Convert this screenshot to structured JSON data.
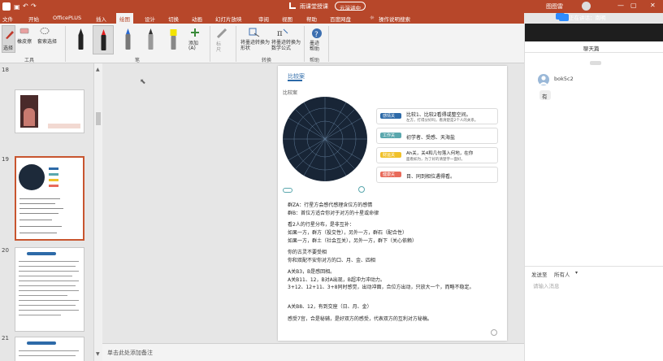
{
  "titlebar": {
    "lecture": "雨课堂授课",
    "status": "云演讲中",
    "user": "图图雷",
    "live_label": "正在讲话：南明"
  },
  "menu": [
    "文件",
    "开始",
    "OfficePLUS",
    "插入",
    "绘图",
    "设计",
    "切换",
    "动画",
    "幻灯片放映",
    "审阅",
    "视图",
    "帮助",
    "百度网盘",
    "操作说明搜索"
  ],
  "ribbon": {
    "tools": [
      "选择",
      "橡皮擦",
      "套索选择"
    ],
    "tools_group": "工具",
    "pens_group": "笔",
    "add_pen": "添加",
    "add_pen_sub": "(A)",
    "ruler": "标尺",
    "convert_shape": "将墨迹转换为形状",
    "convert_math": "将墨迹转换为数学公式",
    "convert_group": "转换",
    "help_btn": "墨迹帮助",
    "help_group": "帮助"
  },
  "thumbs": {
    "numbers": [
      "18",
      "19",
      "20",
      "21"
    ]
  },
  "slide": {
    "header": "比较案",
    "subheader": "比较案",
    "callouts": [
      {
        "tag": "感情关",
        "text": "比较1、比较2看得或整空间。",
        "sub": "左方，打得分好吗，看清楚是2个人的关系。",
        "color": "#2d6aa8"
      },
      {
        "tag": "工作关",
        "text": "初学者、受感、天海盐",
        "sub": "",
        "color": "#5aa7ad"
      },
      {
        "tag": "财运关",
        "text": "Ah关，关4和几句落入何地，在你",
        "sub": "面看如为，为了好的清楚字一面好。",
        "color": "#f0c12a"
      },
      {
        "tag": "健康关",
        "text": "目、同到相位遇得看。",
        "sub": "",
        "color": "#e86a5a"
      }
    ],
    "lines": [
      "群ZA：行星方会感代感理含位方的感情",
      "群B：首位方适合你对于对方的十星或命律",
      "看2人的行星分布，是非互补：",
      "如果一方，群方（投交性），另外一方，群石（配合性）",
      "如果一方，群土（社会互关），另外一方，群下（关心依赖）",
      "你的古灵不要受相",
      "你和双配不安你对方的口、月、金、四相",
      "A关B3，B是感回相。",
      "A关B11、12，B对A出现，B超冲力冲动力。",
      "3+12、12+11、3+8同时感觉，出动冲面，合位方出动，只放大一个，而略不稳定。",
      "A关B8、12，有到交座（日、月、金）",
      "感受7宫，合是秘辅，是好双方的感受，代表双方的互利对方秘稿。"
    ]
  },
  "notes_placeholder": "单击此处添加备注",
  "chat": {
    "header": "聊天篇",
    "sender": "bok5c2",
    "message": "有",
    "send_to_label": "发送至",
    "send_to_value": "所有人",
    "input_placeholder": "请输入消息"
  },
  "colors": {
    "accent": "#b7472a",
    "slide_accent": "#2d6aa8"
  }
}
